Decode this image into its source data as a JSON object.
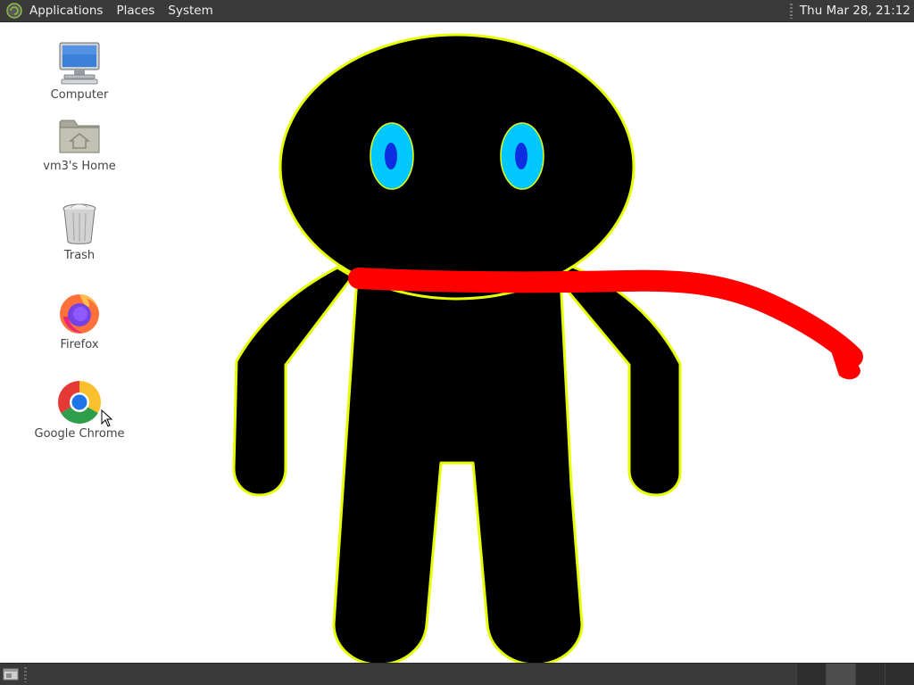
{
  "top_panel": {
    "menus": [
      "Applications",
      "Places",
      "System"
    ],
    "clock": "Thu Mar 28, 21:12"
  },
  "desktop_icons": [
    {
      "label": "Computer",
      "icon": "computer-icon"
    },
    {
      "label": "vm3's Home",
      "icon": "home-folder-icon"
    },
    {
      "label": "Trash",
      "icon": "trash-icon"
    },
    {
      "label": "Firefox",
      "icon": "firefox-icon"
    },
    {
      "label": "Google Chrome",
      "icon": "chrome-icon"
    }
  ],
  "drawing": {
    "figure_fill": "#000000",
    "outline_color": "#e6ff00",
    "eye_color": "#00c8ff",
    "pupil_color": "#0a2ee0",
    "scarf_color": "#ff0000"
  },
  "bottom_panel": {
    "workspaces": 4,
    "active_workspace": 2
  }
}
